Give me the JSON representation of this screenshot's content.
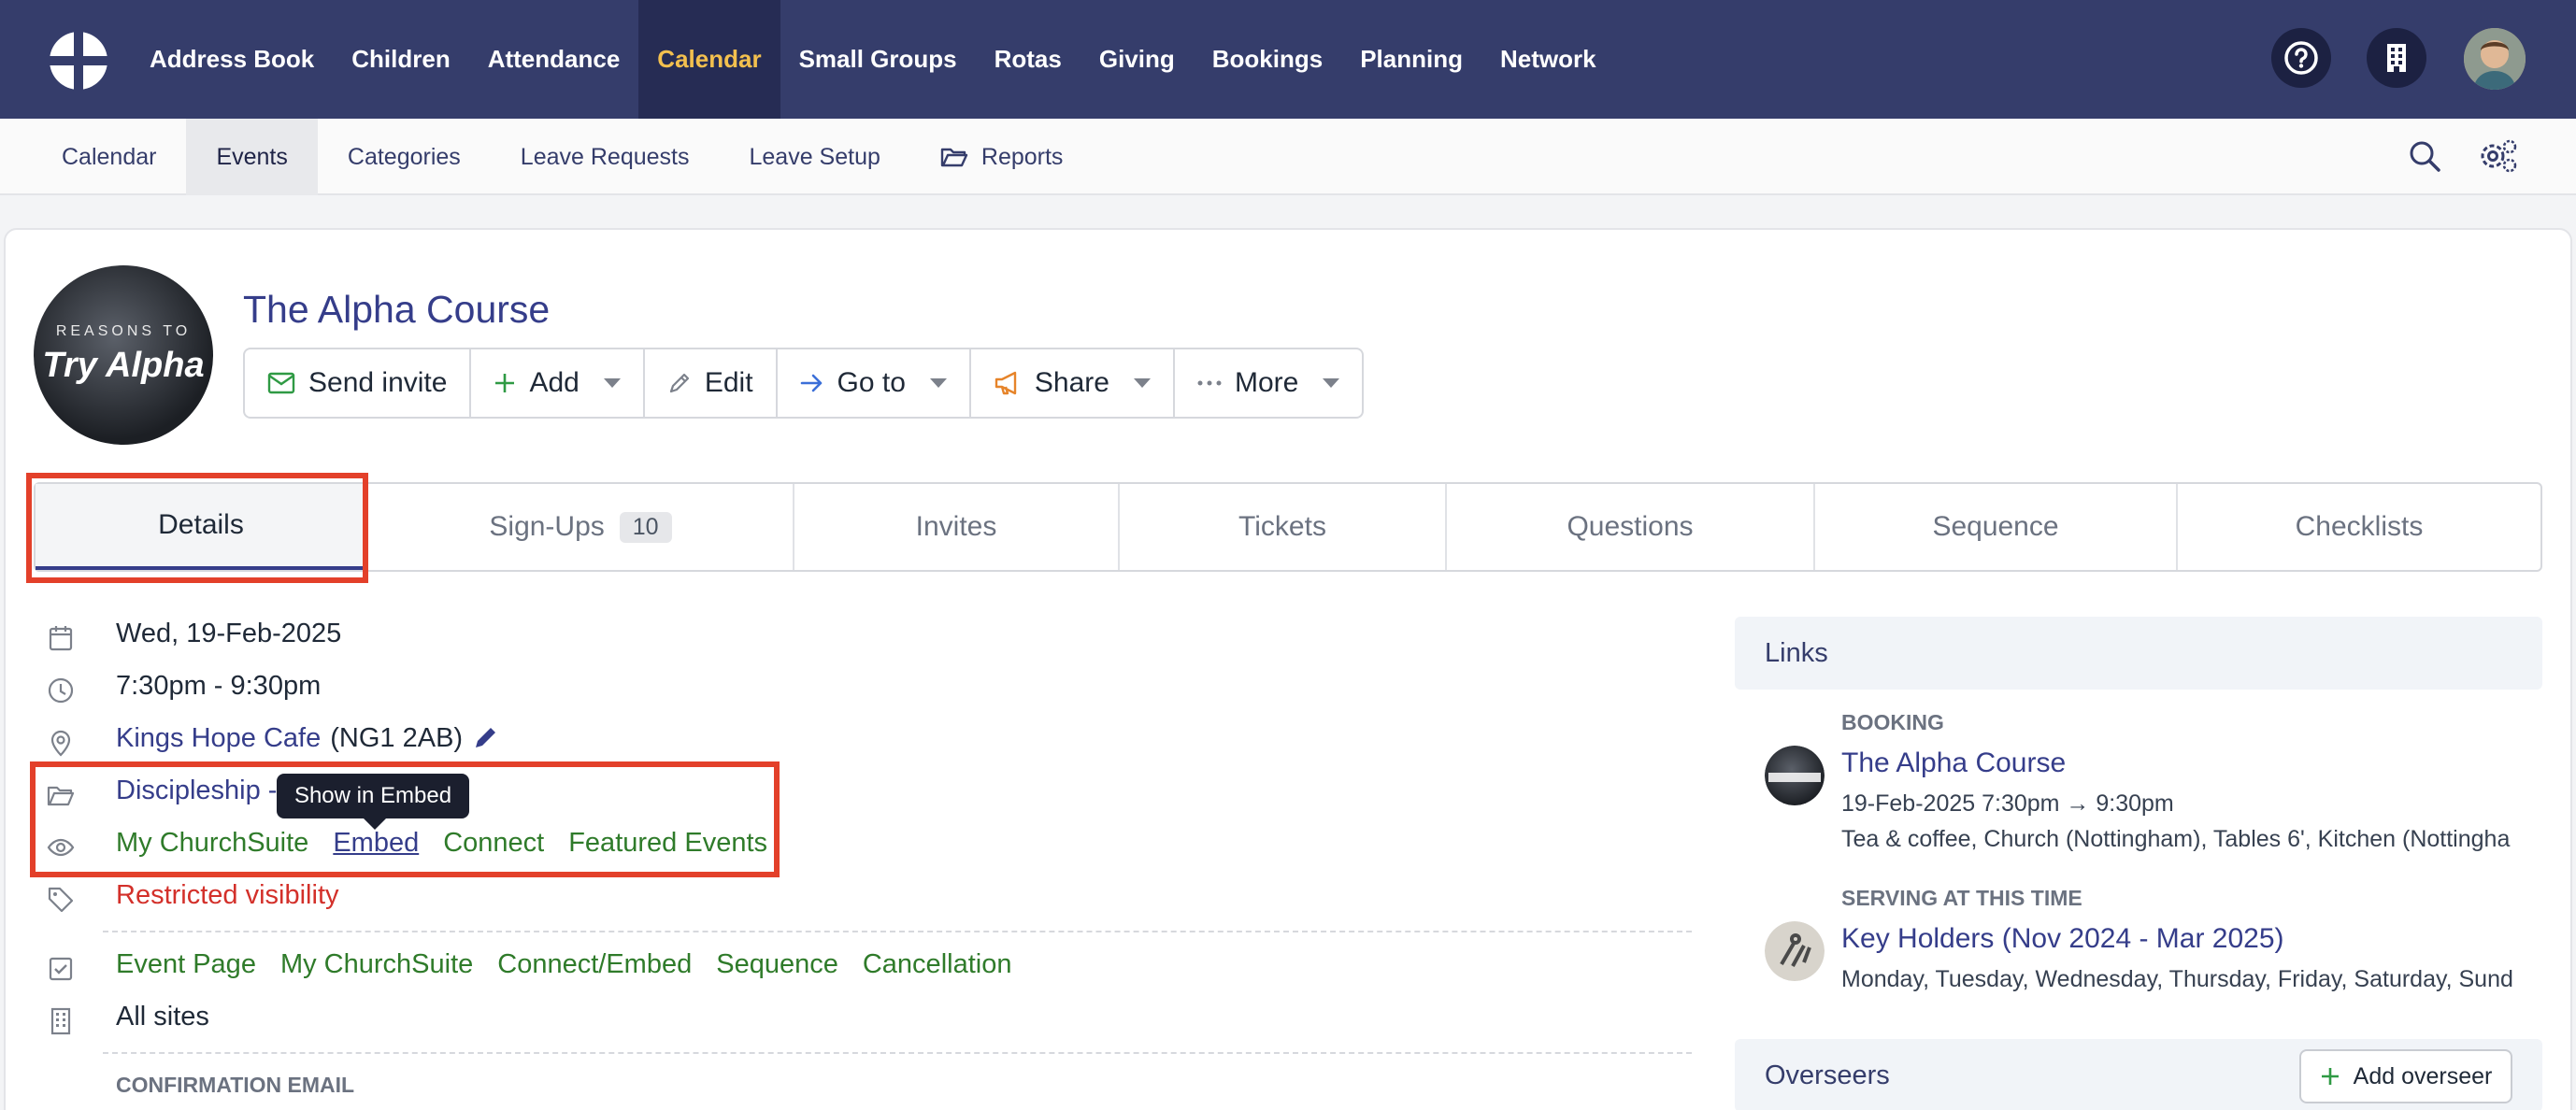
{
  "topnav": {
    "items": [
      "Address Book",
      "Children",
      "Attendance",
      "Calendar",
      "Small Groups",
      "Rotas",
      "Giving",
      "Bookings",
      "Planning",
      "Network"
    ],
    "active": "Calendar",
    "active_color": "#f3c04e"
  },
  "subnav": {
    "items": [
      "Calendar",
      "Events",
      "Categories",
      "Leave Requests",
      "Leave Setup",
      "Reports"
    ],
    "active": "Events"
  },
  "event": {
    "image_text_line1": "REASONS TO",
    "image_text_line2": "Try Alpha",
    "title": "The Alpha Course"
  },
  "actions": {
    "send_invite": "Send invite",
    "add": "Add",
    "edit": "Edit",
    "go_to": "Go to",
    "share": "Share",
    "more": "More"
  },
  "tabs": {
    "details": "Details",
    "signups": "Sign-Ups",
    "signups_count": "10",
    "invites": "Invites",
    "tickets": "Tickets",
    "questions": "Questions",
    "sequence": "Sequence",
    "checklists": "Checklists"
  },
  "details": {
    "date": "Wed, 19-Feb-2025",
    "time": "7:30pm - 9:30pm",
    "location_name": "Kings Hope Cafe",
    "location_postcode": "(NG1 2AB)",
    "category": "Discipleship -",
    "visibility": [
      "My ChurchSuite",
      "Embed",
      "Connect",
      "Featured Events"
    ],
    "tag": "Restricted visibility",
    "features": [
      "Event Page",
      "My ChurchSuite",
      "Connect/Embed",
      "Sequence",
      "Cancellation"
    ],
    "sites": "All sites",
    "confirmation_email_label": "CONFIRMATION EMAIL"
  },
  "tooltip": "Show in Embed",
  "links": {
    "heading": "Links",
    "booking_label": "BOOKING",
    "booking_title": "The Alpha Course",
    "booking_time": "19-Feb-2025 7:30pm → 9:30pm",
    "booking_rooms": "Tea & coffee, Church (Nottingham), Tables 6', Kitchen (Nottingha",
    "serving_label": "SERVING AT THIS TIME",
    "serving_title": "Key Holders (Nov 2024 - Mar 2025)",
    "serving_days": "Monday, Tuesday, Wednesday, Thursday, Friday, Saturday, Sund"
  },
  "overseers": {
    "heading": "Overseers",
    "add_button": "Add overseer"
  },
  "colors": {
    "nav_bg": "#353d6b",
    "link_blue": "#353d8a",
    "feature_green": "#2f7b2a",
    "warning_red": "#d3302a",
    "highlight_box": "#e3402a"
  }
}
